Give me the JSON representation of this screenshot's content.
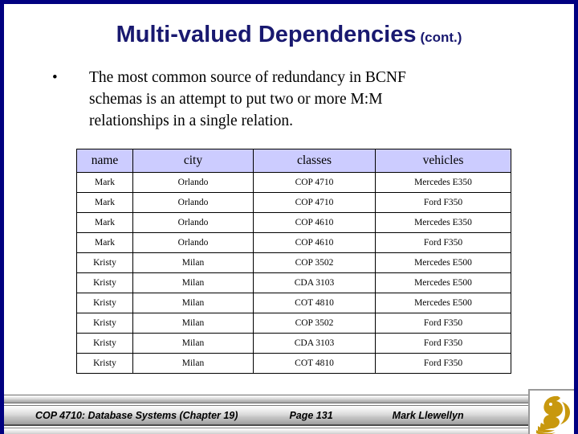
{
  "slide": {
    "border_color": "#000080",
    "background": "#ffffff"
  },
  "title": {
    "main": "Multi-valued Dependencies",
    "suffix": "(cont.)",
    "color": "#191970"
  },
  "bullet": {
    "marker": "•",
    "line1": "The most common source of redundancy in BCNF",
    "line2": "schemas is an attempt to put two or more M:M",
    "line3": "relationships in a single relation.",
    "full_text": "The most common source of redundancy in BCNF schemas is an attempt to put two or more M:M relationships in a single relation."
  },
  "table": {
    "header_background": "#ccccff",
    "columns": [
      "name",
      "city",
      "classes",
      "vehicles"
    ],
    "rows": [
      [
        "Mark",
        "Orlando",
        "COP 4710",
        "Mercedes E350"
      ],
      [
        "Mark",
        "Orlando",
        "COP 4710",
        "Ford F350"
      ],
      [
        "Mark",
        "Orlando",
        "COP 4610",
        "Mercedes E350"
      ],
      [
        "Mark",
        "Orlando",
        "COP 4610",
        "Ford F350"
      ],
      [
        "Kristy",
        "Milan",
        "COP 3502",
        "Mercedes E500"
      ],
      [
        "Kristy",
        "Milan",
        "CDA 3103",
        "Mercedes E500"
      ],
      [
        "Kristy",
        "Milan",
        "COT 4810",
        "Mercedes E500"
      ],
      [
        "Kristy",
        "Milan",
        "COP 3502",
        "Ford F350"
      ],
      [
        "Kristy",
        "Milan",
        "CDA 3103",
        "Ford F350"
      ],
      [
        "Kristy",
        "Milan",
        "COT 4810",
        "Ford F350"
      ]
    ]
  },
  "footer": {
    "course": "COP 4710: Database Systems  (Chapter 19)",
    "page": "Page 131",
    "author": "Mark Llewellyn",
    "logo_name": "ucf-pegasus-logo",
    "logo_color": "#C8980E"
  }
}
